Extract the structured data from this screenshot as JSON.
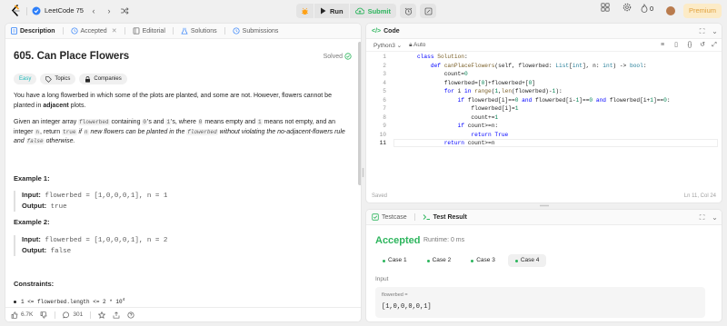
{
  "topnav": {
    "list_title": "LeetCode 75",
    "run_label": "Run",
    "submit_label": "Submit",
    "streak_count": "0",
    "premium_label": "Premium"
  },
  "left_panel": {
    "tabs": [
      {
        "label": "Description",
        "icon": "document-icon"
      },
      {
        "label": "Accepted",
        "icon": "history-icon"
      },
      {
        "label": "Editorial",
        "icon": "book-icon"
      },
      {
        "label": "Solutions",
        "icon": "flask-icon"
      },
      {
        "label": "Submissions",
        "icon": "history-icon"
      }
    ],
    "problem": {
      "title": "605. Can Place Flowers",
      "solved_label": "Solved",
      "difficulty": "Easy",
      "topics_label": "Topics",
      "companies_label": "Companies",
      "para1_a": "You have a long flowerbed in which some of the plots are planted, and some are not. However, flowers cannot be planted in ",
      "para1_b": "adjacent",
      "para1_c": " plots.",
      "para2_a": "Given an integer array ",
      "para2_code1": "flowerbed",
      "para2_b": " containing ",
      "para2_code2": "0",
      "para2_c": "'s and ",
      "para2_code3": "1",
      "para2_d": "'s, where ",
      "para2_code4": "0",
      "para2_e": " means empty and ",
      "para2_code5": "1",
      "para2_f": " means not empty, and an integer ",
      "para2_code6": "n",
      "para2_g": ", return ",
      "para2_code7": "true",
      "para2_h": " if ",
      "para2_code8": "n",
      "para2_i": " new flowers can be planted in the ",
      "para2_code9": "flowerbed",
      "para2_j": " without violating the no-adjacent-flowers rule and ",
      "para2_code10": "false",
      "para2_k": " otherwise.",
      "examples": [
        {
          "heading": "Example 1:",
          "input_label": "Input:",
          "input": "flowerbed = [1,0,0,0,1], n = 1",
          "output_label": "Output:",
          "output": "true"
        },
        {
          "heading": "Example 2:",
          "input_label": "Input:",
          "input": "flowerbed = [1,0,0,0,1], n = 2",
          "output_label": "Output:",
          "output": "false"
        }
      ],
      "constraints_heading": "Constraints:",
      "constraint1": "1 <= flowerbed.length <= 2 * 10",
      "constraint1_sup": "4"
    },
    "footer": {
      "likes": "6.7K",
      "comments": "301"
    }
  },
  "code_panel": {
    "title": "Code",
    "language": "Python3",
    "mode": "Auto",
    "lines": [
      "class Solution:",
      "    def canPlaceFlowers(self, flowerbed: List[int], n: int) -> bool:",
      "        count=0",
      "        flowerbed=[0]+flowerbed+[0]",
      "        for i in range(1,len(flowerbed)-1):",
      "            if flowerbed[i]==0 and flowerbed[i-1]==0 and flowerbed[i+1]==0:",
      "                flowerbed[i]=1",
      "                count+=1",
      "            if count>=n:",
      "                return True",
      "        return count>=n"
    ],
    "line_numbers": [
      "1",
      "2",
      "3",
      "4",
      "5",
      "6",
      "7",
      "8",
      "9",
      "10",
      "11"
    ],
    "status_left": "Saved",
    "status_right": "Ln 11, Col 24"
  },
  "result_panel": {
    "tabs": [
      {
        "label": "Testcase",
        "icon": "checkbox-icon"
      },
      {
        "label": "Test Result",
        "icon": "terminal-icon"
      }
    ],
    "verdict": "Accepted",
    "runtime": "Runtime: 0 ms",
    "cases": [
      "Case 1",
      "Case 2",
      "Case 3",
      "Case 4"
    ],
    "active_case": 3,
    "input_label": "Input",
    "param_name": "flowerbed =",
    "param_value": "[1,0,0,0,0,1]"
  },
  "colors": {
    "accent_green": "#2db55d",
    "easy_teal": "#1cb8b8",
    "premium_gold": "#e0a03d"
  }
}
